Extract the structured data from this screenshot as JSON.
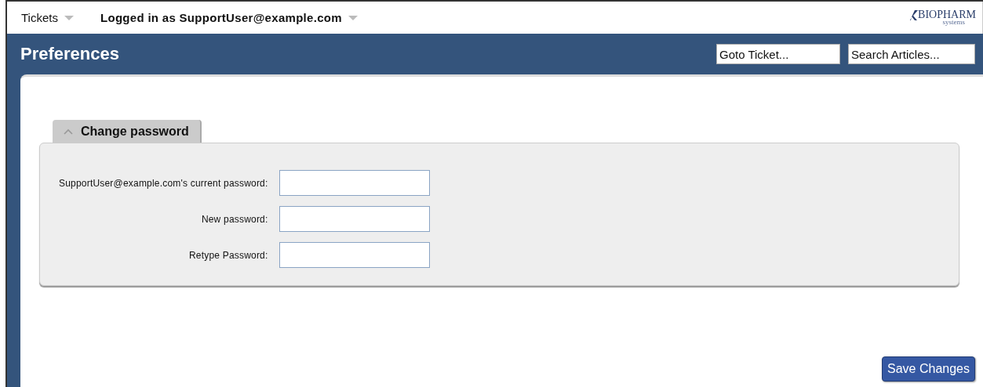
{
  "menu_bar": {
    "items": [
      {
        "label": "Tickets"
      },
      {
        "label": "Logged in as SupportUser@example.com"
      }
    ],
    "logo": {
      "name": "BIOPHARM",
      "tagline": "systems"
    }
  },
  "header": {
    "title": "Preferences",
    "fields": [
      {
        "placeholder": "Goto Ticket..."
      },
      {
        "placeholder": "Search Articles..."
      }
    ]
  },
  "section": {
    "title": "Change password",
    "expanded": true,
    "fields": [
      {
        "label": "SupportUser@example.com's current password:"
      },
      {
        "label": "New password:"
      },
      {
        "label": "Retype Password:"
      }
    ]
  },
  "buttons": [
    "Save Changes"
  ]
}
